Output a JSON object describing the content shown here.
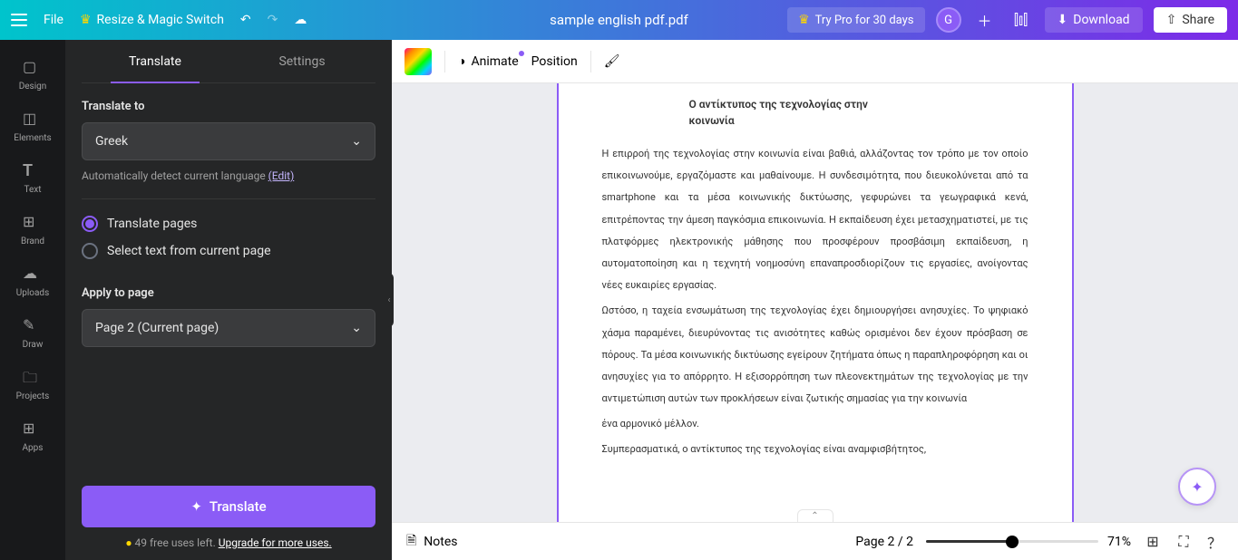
{
  "topbar": {
    "file": "File",
    "resize": "Resize & Magic Switch",
    "doc_title": "sample english pdf.pdf",
    "try_pro": "Try Pro for 30 days",
    "avatar_letter": "G",
    "download": "Download",
    "share": "Share"
  },
  "leftrail": {
    "items": [
      "Design",
      "Elements",
      "Text",
      "Brand",
      "Uploads",
      "Draw",
      "Projects",
      "Apps"
    ]
  },
  "sidepanel": {
    "tabs": {
      "translate": "Translate",
      "settings": "Settings"
    },
    "translate_to_label": "Translate to",
    "language_value": "Greek",
    "auto_detect": "Automatically detect current language ",
    "edit_link": "(Edit)",
    "radio_pages": "Translate pages",
    "radio_select": "Select text from current page",
    "apply_label": "Apply to page",
    "page_value": "Page 2 (Current page)",
    "translate_btn": "Translate",
    "uses_prefix": "49 free uses left. ",
    "uses_link": "Upgrade for more uses."
  },
  "canvas_toolbar": {
    "animate": "Animate",
    "position": "Position"
  },
  "document": {
    "title": "Ο αντίκτυπος της τεχνολογίας στην κοινωνία",
    "paragraphs": [
      "Η επιρροή της τεχνολογίας στην κοινωνία είναι βαθιά, αλλάζοντας τον τρόπο με τον οποίο επικοινωνούμε, εργαζόμαστε και μαθαίνουμε. Η συνδεσιμότητα, που διευκολύνεται από τα smartphone και τα μέσα κοινωνικής δικτύωσης, γεφυρώνει τα γεωγραφικά κενά, επιτρέποντας την άμεση παγκόσμια επικοινωνία. Η εκπαίδευση έχει μετασχηματιστεί, με τις πλατφόρμες ηλεκτρονικής μάθησης που προσφέρουν προσβάσιμη εκπαίδευση, η αυτοματοποίηση και η τεχνητή νοημοσύνη επαναπροσδιορίζουν τις εργασίες, ανοίγοντας νέες ευκαιρίες εργασίας.",
      "Ωστόσο, η ταχεία ενσωμάτωση της τεχνολογίας έχει δημιουργήσει ανησυχίες. Το ψηφιακό χάσμα παραμένει, διευρύνοντας τις ανισότητες καθώς ορισμένοι δεν έχουν πρόσβαση σε πόρους. Τα μέσα κοινωνικής δικτύωσης εγείρουν ζητήματα όπως η παραπληροφόρηση και οι ανησυχίες για το απόρρητο. Η εξισορρόπηση των πλεονεκτημάτων της τεχνολογίας με την αντιμετώπιση αυτών των προκλήσεων είναι ζωτικής σημασίας για την κοινωνία",
      "ένα αρμονικό μέλλον.",
      "Συμπερασματικά, ο αντίκτυπος της τεχνολογίας είναι αναμφισβήτητος,"
    ]
  },
  "bottombar": {
    "notes": "Notes",
    "page_indicator": "Page 2 / 2",
    "zoom_pct": "71%"
  }
}
